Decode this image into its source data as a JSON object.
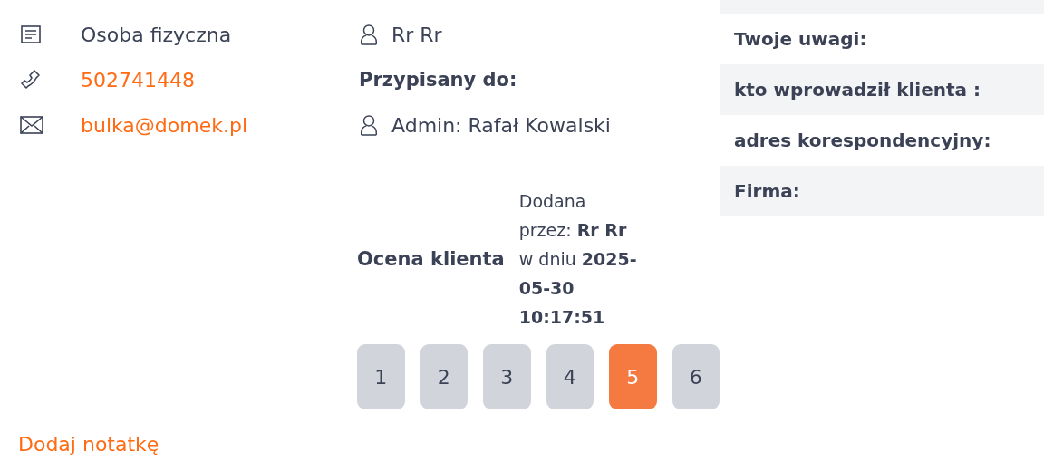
{
  "contact": [
    {
      "kind": "type",
      "text": "Osoba fizyczna"
    },
    {
      "kind": "phone",
      "text": "502741448"
    },
    {
      "kind": "email",
      "text": "bulka@domek.pl"
    }
  ],
  "owner": {
    "name": "Rr Rr",
    "assigned_label": "Przypisany do:",
    "assigned_name": "Admin: Rafał Kowalski"
  },
  "details": [
    {
      "label": "Twoje uwagi:"
    },
    {
      "label": "kto wprowadził klienta :"
    },
    {
      "label": "adres korespondencyjny:"
    },
    {
      "label": "Firma:"
    }
  ],
  "rating": {
    "title": "Ocena klienta",
    "info": "Dodana przez: **Rr Rr** w dniu **2025-05-30 10:17:51**",
    "options": [
      {
        "label": "1",
        "selected": false
      },
      {
        "label": "2",
        "selected": false
      },
      {
        "label": "3",
        "selected": false
      },
      {
        "label": "4",
        "selected": false
      },
      {
        "label": "5",
        "selected": true
      },
      {
        "label": "6",
        "selected": false
      }
    ]
  },
  "add_note_link": "Dodaj notatkę"
}
